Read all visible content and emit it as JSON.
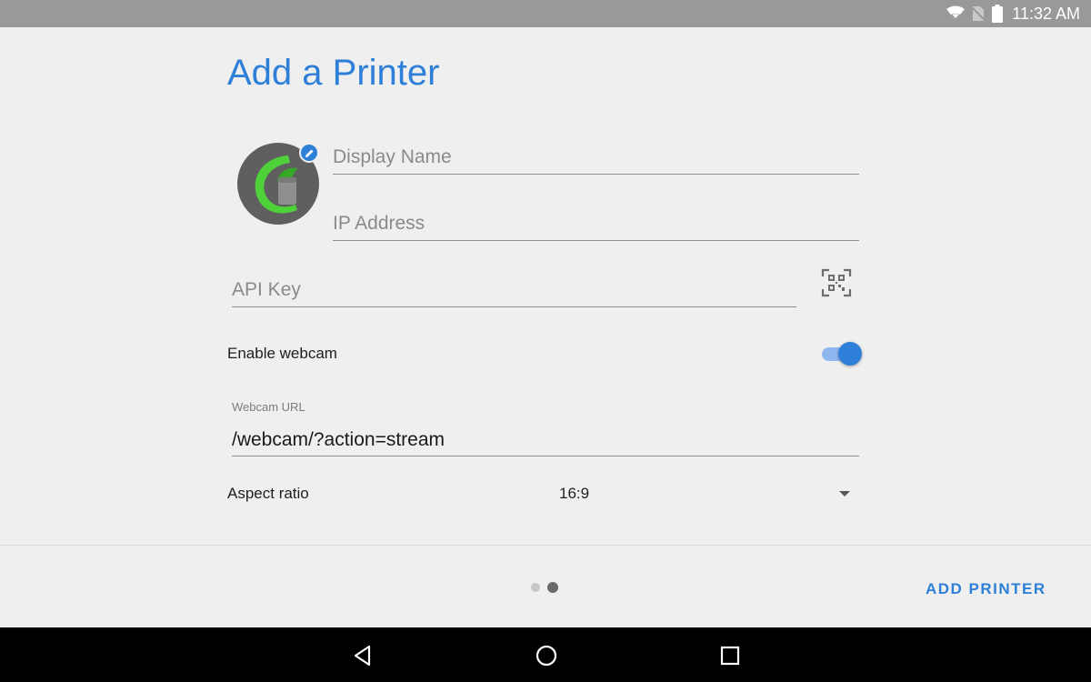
{
  "status_bar": {
    "time": "11:32 AM",
    "icons": [
      "wifi-icon",
      "no-sim-icon",
      "battery-icon"
    ]
  },
  "page": {
    "title": "Add a Printer"
  },
  "form": {
    "display_name_placeholder": "Display Name",
    "ip_address_placeholder": "IP Address",
    "api_key_placeholder": "API Key",
    "enable_webcam_label": "Enable webcam",
    "enable_webcam_on": true,
    "webcam_url_label": "Webcam URL",
    "webcam_url_value": "/webcam/?action=stream",
    "aspect_ratio_label": "Aspect ratio",
    "aspect_ratio_value": "16:9"
  },
  "footer": {
    "page_count": 2,
    "current_page": 2,
    "add_printer_label": "ADD PRINTER"
  },
  "colors": {
    "accent": "#2e7fd8",
    "status_bar": "#999999",
    "background": "#efefef",
    "nav_bar": "#000000"
  }
}
